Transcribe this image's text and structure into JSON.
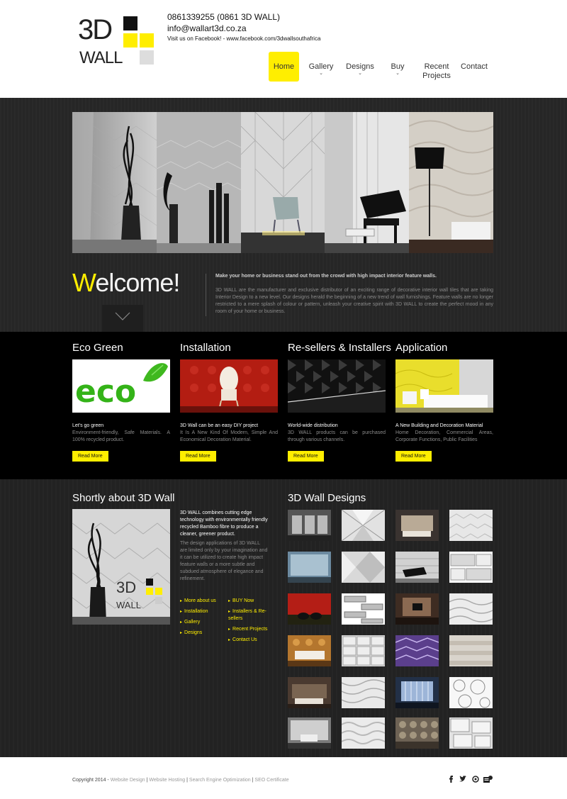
{
  "header": {
    "logo_main": "3D",
    "logo_sub": "WALL",
    "phone": "0861339255 (0861 3D WALL)",
    "email": "info@wallart3d.co.za",
    "facebook_text": "Visit us on Facebook! - www.facebook.com/3dwallsouthafrica"
  },
  "nav": {
    "items": [
      {
        "label": "Home",
        "active": true,
        "dropdown": false
      },
      {
        "label": "Gallery",
        "active": false,
        "dropdown": true
      },
      {
        "label": "Designs",
        "active": false,
        "dropdown": true
      },
      {
        "label": "Buy",
        "active": false,
        "dropdown": true
      },
      {
        "label": "Recent Projects",
        "active": false,
        "dropdown": false
      },
      {
        "label": "Contact",
        "active": false,
        "dropdown": false
      }
    ]
  },
  "welcome": {
    "first_letter": "W",
    "rest": "elcome!",
    "lead": "Make your home or business stand out from the crowd with high impact interior feature walls.",
    "body": "3D WALL are the manufacturer and exclusive distributor of an exciting range of decorative interior wall tiles that are taking Interior Design to a new level. Our designs herald the beginning of a new trend of wall furnishings. Feature walls are no longer restricted to a mere splash of colour or pattern, unleash your creative spirit with 3D WALL to create the perfect mood in any room of your home or business."
  },
  "features": [
    {
      "title": "Eco Green",
      "subtitle": "Let's go green",
      "description": "Environment-friendly, Safe Materials. A 100% recycled product.",
      "button": "Read More"
    },
    {
      "title": "Installation",
      "subtitle": "3D Wall can be an easy DIY project",
      "description": "It Is A New Kind Of Modern, Simple And Economical Decoration Material.",
      "button": "Read More"
    },
    {
      "title": "Re-sellers & Installers",
      "subtitle": "World-wide distribution",
      "description": "3D WALL products can be purchased through various channels.",
      "button": "Read More"
    },
    {
      "title": "Application",
      "subtitle": "A New Building and Decoration Material",
      "description": "Home Decoration, Commercial Areas, Corporate Functions, Public Facilities",
      "button": "Read More"
    }
  ],
  "about": {
    "title": "Shortly about 3D Wall",
    "lead": "3D WALL combines cutting edge technology with environmentally friendly recycled Bamboo fibre to produce a cleaner, greener product.",
    "body": "The design applications of 3D WALL are limited only by your imagination and it can be utilized to create high impact feature walls or a more subtle and subdued atmosphere of elegance and refinement.",
    "links_left": [
      "More about us",
      "Installation",
      "Gallery",
      "Designs"
    ],
    "links_right": [
      "BUY Now",
      "Installers & Re-sellers",
      "Recent Projects",
      "Contact Us"
    ]
  },
  "designs": {
    "title": "3D Wall Designs"
  },
  "footer": {
    "copyright": "Copyright 2014 -",
    "links": [
      "Website Design",
      "Website Hosting",
      "Search Engine Optimization",
      "SEO Certificate"
    ],
    "social": [
      "facebook-icon",
      "twitter-icon",
      "feed-icon",
      "contact-icon"
    ]
  },
  "colors": {
    "accent": "#ffee00",
    "dark": "#262626",
    "black": "#000000"
  }
}
